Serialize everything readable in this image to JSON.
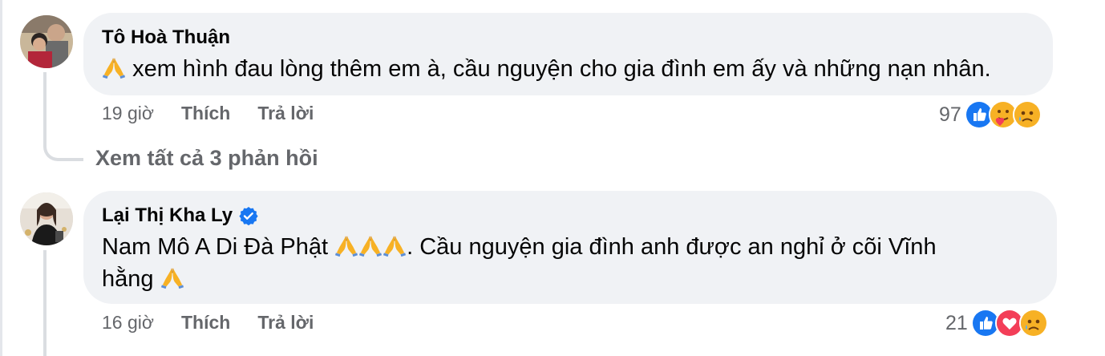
{
  "comments": [
    {
      "author": "Tô Hoà Thuận",
      "verified": false,
      "text": "xem hình đau lòng thêm em à, cầu nguyện cho gia đình em ấy và những nạn nhân.",
      "time": "19 giờ",
      "like_label": "Thích",
      "reply_label": "Trả lời",
      "reaction_count": "97",
      "reactions": [
        "like-icon",
        "care-icon",
        "sad-icon"
      ]
    },
    {
      "author": "Lại Thị Kha Ly",
      "verified": true,
      "text_part1": "Nam Mô A Di Đà Phật",
      "text_part2": ". Cầu nguyện gia đình anh được an nghỉ ở cõi Vĩnh",
      "text_line2": "hằng",
      "time": "16 giờ",
      "like_label": "Thích",
      "reply_label": "Trả lời",
      "reaction_count": "21",
      "reactions": [
        "like-icon",
        "love-icon",
        "sad-icon"
      ]
    }
  ],
  "view_replies": "Xem tất cả 3 phản hồi",
  "colors": {
    "bubble": "#f0f2f5",
    "meta_text": "#65676b",
    "like_blue": "#1877f2",
    "love_red": "#f33e58",
    "emoji_yellow": "#f7b125"
  }
}
